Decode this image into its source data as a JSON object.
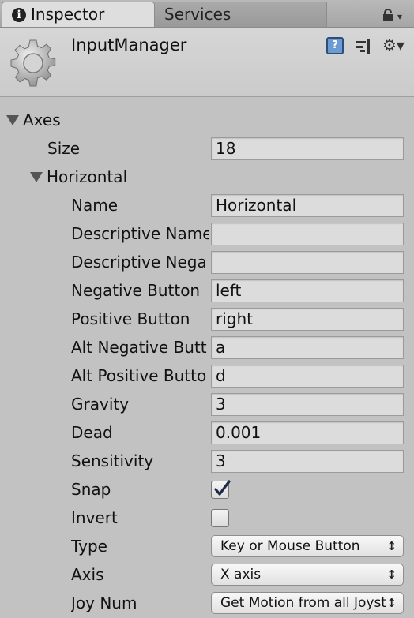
{
  "tabs": {
    "inspector": "Inspector",
    "services": "Services"
  },
  "header": {
    "title": "InputManager"
  },
  "axes": {
    "label": "Axes",
    "size_label": "Size",
    "size_value": "18",
    "axis": {
      "label": "Horizontal",
      "name_label": "Name",
      "name_value": "Horizontal",
      "descriptive_name_label": "Descriptive Name",
      "descriptive_name_value": "",
      "descriptive_negative_label": "Descriptive Nega",
      "descriptive_negative_value": "",
      "negative_button_label": "Negative Button",
      "negative_button_value": "left",
      "positive_button_label": "Positive Button",
      "positive_button_value": "right",
      "alt_negative_label": "Alt Negative Butt",
      "alt_negative_value": "a",
      "alt_positive_label": "Alt Positive Butto",
      "alt_positive_value": "d",
      "gravity_label": "Gravity",
      "gravity_value": "3",
      "dead_label": "Dead",
      "dead_value": "0.001",
      "sensitivity_label": "Sensitivity",
      "sensitivity_value": "3",
      "snap_label": "Snap",
      "snap_checked": true,
      "invert_label": "Invert",
      "invert_checked": false,
      "type_label": "Type",
      "type_value": "Key or Mouse Button",
      "axis_label": "Axis",
      "axis_value": "X axis",
      "joy_num_label": "Joy Num",
      "joy_num_value": "Get Motion from all Joysticks"
    }
  },
  "icons": {
    "tab_info": "info-icon",
    "lock": "lock-icon",
    "component": "gear-icon",
    "help": "help-icon",
    "presets": "preset-icon",
    "settings": "settings-icon"
  },
  "colors": {
    "panel_bg": "#c2c2c2",
    "field_bg": "#dcdcdc",
    "help_blue": "#6d9bd1"
  }
}
